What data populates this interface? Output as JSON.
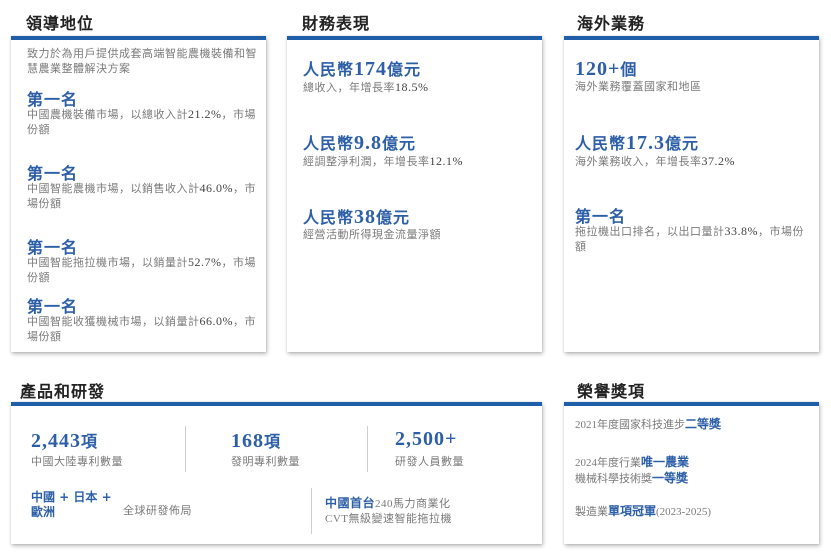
{
  "leadership": {
    "title": "領導地位",
    "intro": "致力於為用戶提供成套高端智能農機裝備和智慧農業整體解決方案",
    "items": [
      {
        "rank": "第一名",
        "desc": "中國農機裝備市場，以總收入計",
        "value": "21.2%",
        "suffix": "，市場份額"
      },
      {
        "rank": "第一名",
        "desc": "中國智能農機市場，以銷售收入計",
        "value": "46.0%",
        "suffix": "，市場份額"
      },
      {
        "rank": "第一名",
        "desc": "中國智能拖拉機市場，以銷量計",
        "value": "52.7%",
        "suffix": "，市場份額"
      },
      {
        "rank": "第一名",
        "desc": "中國智能收獲機械市場，以銷量計",
        "value": "66.0%",
        "suffix": "，市場份額"
      }
    ]
  },
  "financial": {
    "title": "財務表現",
    "items": [
      {
        "prefix": "人民幣",
        "num": "174",
        "unit": "億元",
        "desc": "總收入，年增長率",
        "value": "18.5%"
      },
      {
        "prefix": "人民幣",
        "num": "9.8",
        "unit": "億元",
        "desc": "經調整淨利潤，年增長率",
        "value": "12.1%"
      },
      {
        "prefix": "人民幣",
        "num": "38",
        "unit": "億元",
        "desc": "經營活動所得現金流量淨額",
        "value": ""
      }
    ]
  },
  "overseas": {
    "title": "海外業務",
    "count_num": "120+",
    "count_unit": "個",
    "count_desc": "海外業務覆蓋國家和地區",
    "revenue_prefix": "人民幣",
    "revenue_num": "17.3",
    "revenue_unit": "億元",
    "revenue_desc": "海外業務收入，年增長率",
    "revenue_value": "37.2%",
    "rank": "第一名",
    "rank_desc": "拖拉機出口排名，以出口量計",
    "rank_value": "33.8%",
    "rank_suffix": "，市場份額"
  },
  "products": {
    "title": "產品和研發",
    "stats": [
      {
        "num": "2,443",
        "unit": "項",
        "label": "中國大陸專利數量"
      },
      {
        "num": "168",
        "unit": "項",
        "label": "發明專利數量"
      },
      {
        "num": "2,500+",
        "unit": "",
        "label": "研發人員數量"
      }
    ],
    "global_line1": "中國 + 日本 +",
    "global_line2": "歐洲",
    "global_label": "全球研發佈局",
    "first_highlight": "中國首台",
    "first_text": "240馬力商業化",
    "first_line2": "CVT無級變速智能拖拉機"
  },
  "honors": {
    "title": "榮譽獎項",
    "items": [
      {
        "pre": "2021年度國家科技進步",
        "hl": "二等獎",
        "line2_pre": "",
        "line2_hl": ""
      },
      {
        "pre": "2024年度行業",
        "hl": "唯一農業",
        "line2_pre": "機械科學技術獎",
        "line2_hl": "一等獎"
      },
      {
        "pre": "製造業",
        "hl": "單項冠軍",
        "line2_pre": "(2023-2025)",
        "line2_hl": ""
      }
    ]
  }
}
